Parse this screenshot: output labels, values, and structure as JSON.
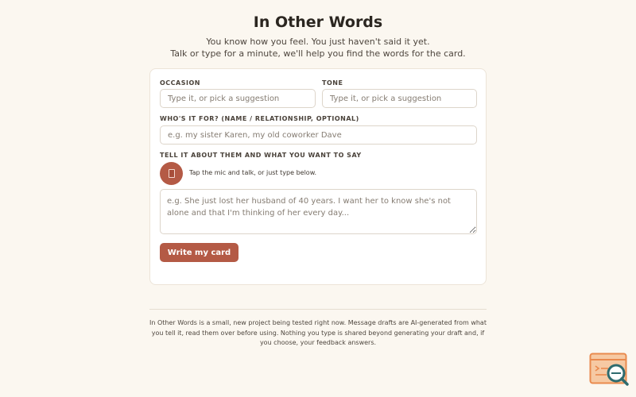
{
  "header": {
    "title": "In Other Words",
    "subtitle_line1": "You know how you feel. You just haven't said it yet.",
    "subtitle_line2": "Talk or type for a minute, we'll help you find the words for the card."
  },
  "form": {
    "occasion": {
      "label": "OCCASION",
      "placeholder": "Type it, or pick a suggestion",
      "value": ""
    },
    "tone": {
      "label": "TONE",
      "placeholder": "Type it, or pick a suggestion",
      "value": ""
    },
    "recipient": {
      "label": "WHO'S IT FOR? (NAME / RELATIONSHIP, OPTIONAL)",
      "placeholder": "e.g. my sister Karen, my old coworker Dave",
      "value": ""
    },
    "message": {
      "label": "TELL IT ABOUT THEM AND WHAT YOU WANT TO SAY",
      "mic_hint": "Tap the mic and talk, or just type below.",
      "placeholder": "e.g. She just lost her husband of 40 years. I want her to know she's not alone and that I'm thinking of her every day...",
      "value": ""
    },
    "submit_label": "Write my card"
  },
  "footer": {
    "text": "In Other Words is a small, new project being tested right now. Message drafts are AI-generated from what you tell it, read them over before using. Nothing you type is shared beyond generating your draft and, if you choose, your feedback answers."
  },
  "icons": {
    "mic": "microphone-icon",
    "widget": "search-feedback-icon"
  },
  "colors": {
    "accent": "#b45a45",
    "background": "#fbf7f0",
    "card": "#ffffff",
    "widget_orange": "#e98a4e",
    "widget_teal": "#2e6b6e"
  }
}
